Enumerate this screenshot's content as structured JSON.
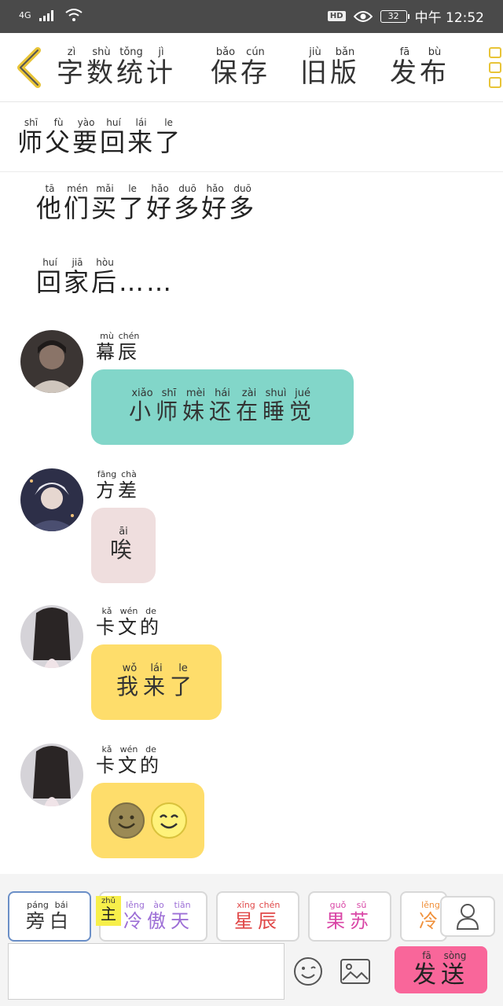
{
  "status_bar": {
    "network": "4G",
    "hd": "HD",
    "battery": "32",
    "time": "中午 12:52"
  },
  "header": {
    "title": [
      {
        "c": "字",
        "p": "zì"
      },
      {
        "c": "数",
        "p": "shù"
      },
      {
        "c": "统",
        "p": "tǒng"
      },
      {
        "c": "计",
        "p": "jì"
      }
    ],
    "save": [
      {
        "c": "保",
        "p": "bǎo"
      },
      {
        "c": "存",
        "p": "cún"
      }
    ],
    "old": [
      {
        "c": "旧",
        "p": "jiù"
      },
      {
        "c": "版",
        "p": "bǎn"
      }
    ],
    "publish": [
      {
        "c": "发",
        "p": "fā"
      },
      {
        "c": "布",
        "p": "bù"
      }
    ]
  },
  "narrations": [
    [
      {
        "c": "师",
        "p": "shī"
      },
      {
        "c": "父",
        "p": "fù"
      },
      {
        "c": "要",
        "p": "yào"
      },
      {
        "c": "回",
        "p": "huí"
      },
      {
        "c": "来",
        "p": "lái"
      },
      {
        "c": "了",
        "p": "le"
      }
    ],
    [
      {
        "c": "他",
        "p": "tā"
      },
      {
        "c": "们",
        "p": "mén"
      },
      {
        "c": "买",
        "p": "mǎi"
      },
      {
        "c": "了",
        "p": "le"
      },
      {
        "c": "好",
        "p": "hǎo"
      },
      {
        "c": "多",
        "p": "duō"
      },
      {
        "c": "好",
        "p": "hǎo"
      },
      {
        "c": "多",
        "p": "duō"
      }
    ],
    [
      {
        "c": "回",
        "p": "huí"
      },
      {
        "c": "家",
        "p": "jiā"
      },
      {
        "c": "后",
        "p": "hòu"
      },
      {
        "c": "……",
        "p": ""
      }
    ]
  ],
  "messages": [
    {
      "sender": [
        {
          "c": "幕",
          "p": "mù"
        },
        {
          "c": "辰",
          "p": "chén"
        }
      ],
      "text": [
        {
          "c": "小",
          "p": "xiǎo"
        },
        {
          "c": "师",
          "p": "shī"
        },
        {
          "c": "妹",
          "p": "mèi"
        },
        {
          "c": "还",
          "p": "hái"
        },
        {
          "c": "在",
          "p": "zài"
        },
        {
          "c": "睡",
          "p": "shuì"
        },
        {
          "c": "觉",
          "p": "jué"
        }
      ],
      "bubble_color": "#82d6c9"
    },
    {
      "sender": [
        {
          "c": "方",
          "p": "fāng"
        },
        {
          "c": "差",
          "p": "chà"
        }
      ],
      "text": [
        {
          "c": "唉",
          "p": "āi"
        }
      ],
      "bubble_color": "#efdede"
    },
    {
      "sender": [
        {
          "c": "卡",
          "p": "kǎ"
        },
        {
          "c": "文",
          "p": "wén"
        },
        {
          "c": "的",
          "p": "de"
        }
      ],
      "text": [
        {
          "c": "我",
          "p": "wǒ"
        },
        {
          "c": "来",
          "p": "lái"
        },
        {
          "c": "了",
          "p": "le"
        }
      ],
      "bubble_color": "#fedd6b"
    },
    {
      "sender": [
        {
          "c": "卡",
          "p": "kǎ"
        },
        {
          "c": "文",
          "p": "wén"
        },
        {
          "c": "的",
          "p": "de"
        }
      ],
      "emojis": [
        "smiling-face-icon",
        "smiling-face-icon"
      ],
      "bubble_color": "#fedd6b"
    }
  ],
  "roles": [
    {
      "chars": [
        {
          "c": "旁",
          "p": "páng"
        },
        {
          "c": "白",
          "p": "bái"
        }
      ],
      "color": "#333333",
      "selected": true
    },
    {
      "chars": [
        {
          "c": "冷",
          "p": "lěng"
        },
        {
          "c": "傲",
          "p": "ào"
        },
        {
          "c": "天",
          "p": "tiān"
        }
      ],
      "color": "#9d6fd6",
      "selected": false
    },
    {
      "chars": [
        {
          "c": "星",
          "p": "xīng"
        },
        {
          "c": "辰",
          "p": "chén"
        }
      ],
      "color": "#e04848",
      "selected": false
    },
    {
      "chars": [
        {
          "c": "果",
          "p": "guǒ"
        },
        {
          "c": "苏",
          "p": "sū"
        }
      ],
      "color": "#d946a6",
      "selected": false
    },
    {
      "chars": [
        {
          "c": "冷",
          "p": "lěng"
        }
      ],
      "color": "#f0903a",
      "selected": false
    }
  ],
  "protagonist_tag": {
    "c": "主",
    "p": "zhǔ"
  },
  "input": {
    "value": "",
    "placeholder": ""
  },
  "send": [
    {
      "c": "发",
      "p": "fā"
    },
    {
      "c": "送",
      "p": "sòng"
    }
  ],
  "colors": {
    "accent_yellow": "#e8c437",
    "send_pink": "#f9669a",
    "selected_border": "#6b8fc7"
  }
}
